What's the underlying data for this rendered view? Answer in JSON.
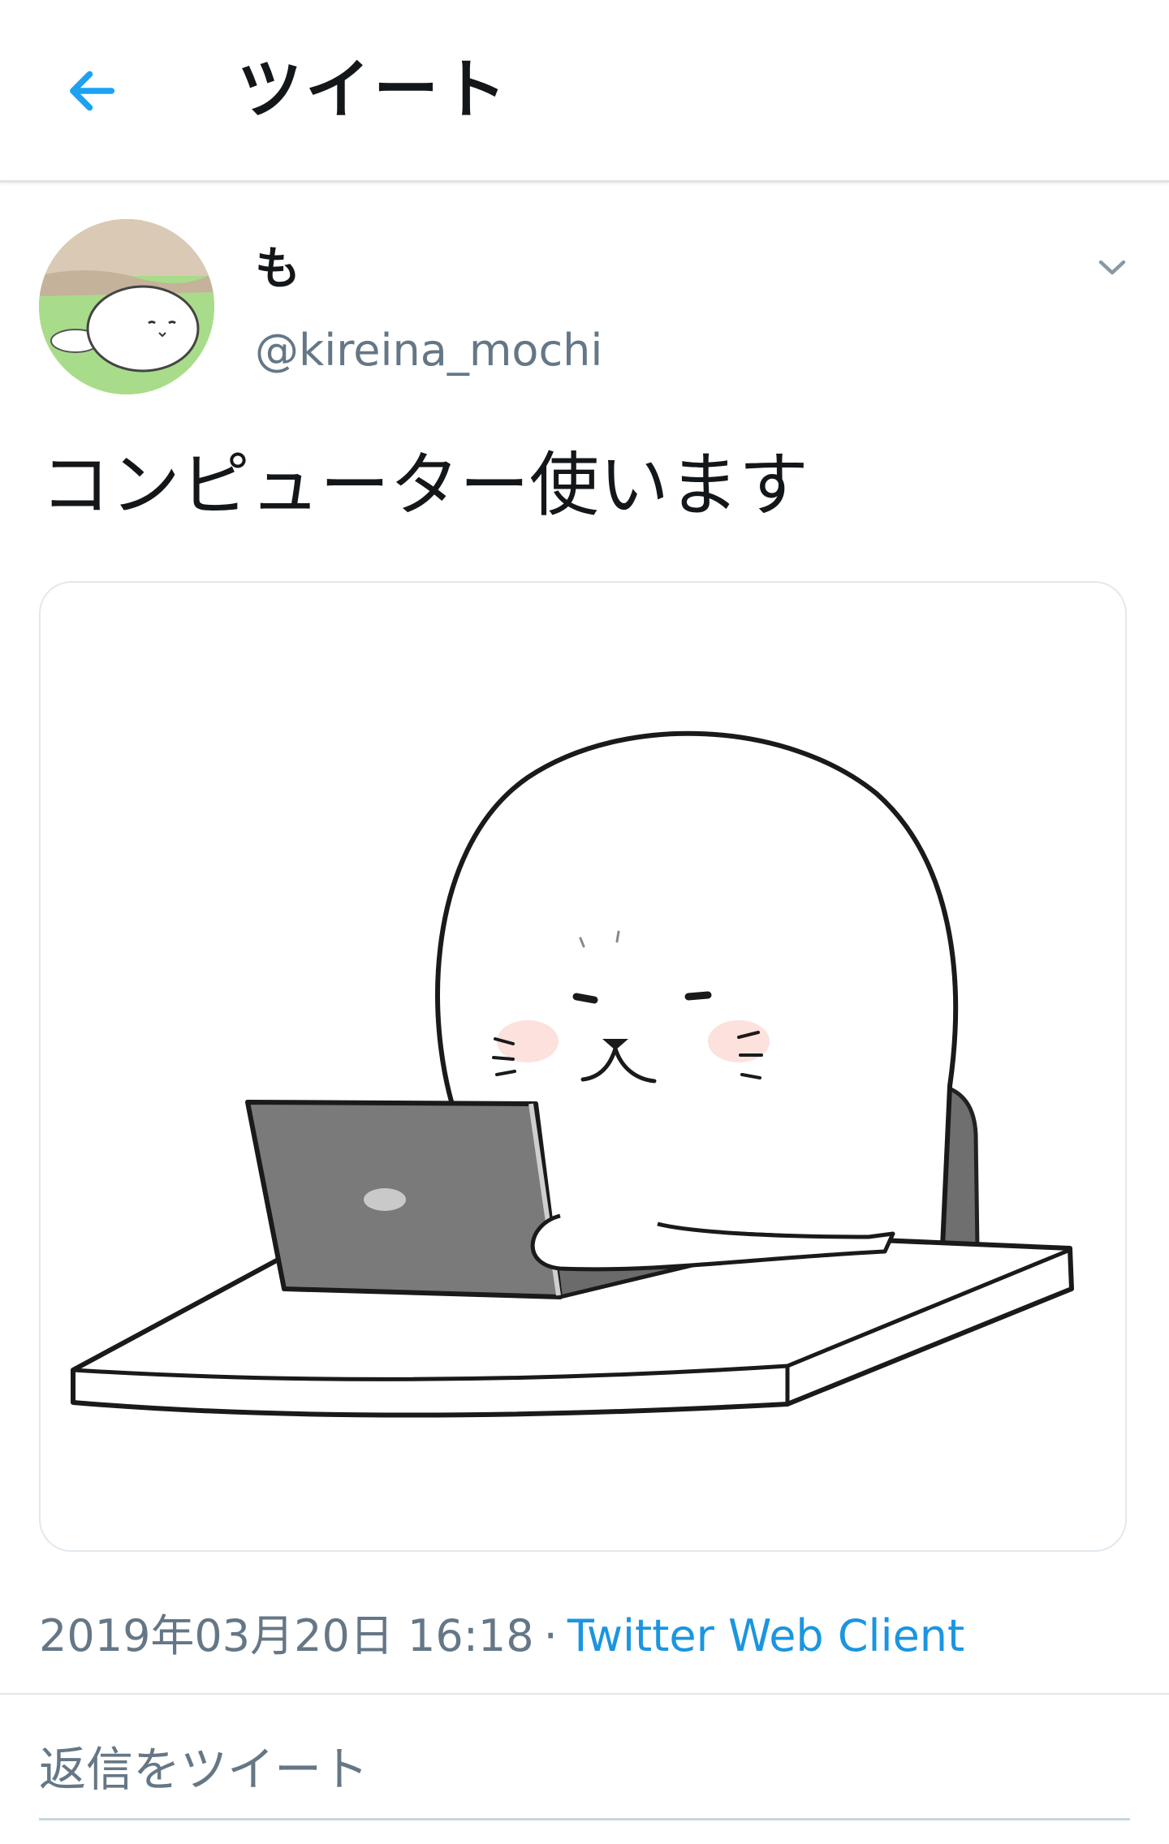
{
  "header": {
    "title": "ツイート",
    "back_icon": "arrow-left-icon",
    "accent_color": "#1da1f2"
  },
  "tweet": {
    "author": {
      "display_name": "も",
      "screen_name": "@kireina_mochi"
    },
    "menu_icon": "chevron-down-icon",
    "text": "コンピューター使います",
    "timestamp": "2019年03月20日 16:18",
    "separator": "·",
    "client": "Twitter Web Client"
  },
  "reply": {
    "placeholder": "返信をツイート"
  }
}
